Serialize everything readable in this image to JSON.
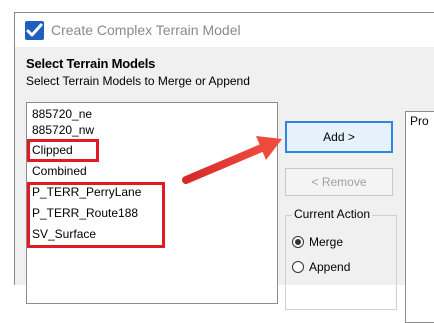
{
  "window": {
    "title": "Create Complex Terrain Model"
  },
  "section": {
    "title": "Select Terrain Models",
    "description": "Select Terrain Models to Merge or Append"
  },
  "terrain_list": {
    "items": [
      "885720_ne",
      "885720_nw",
      "Clipped",
      "Combined",
      "P_TERR_PerryLane",
      "P_TERR_Route188",
      "SV_Surface"
    ]
  },
  "buttons": {
    "add": "Add >",
    "remove": "< Remove"
  },
  "current_action": {
    "legend": "Current Action",
    "options": [
      "Merge",
      "Append"
    ],
    "selected": "Merge"
  },
  "properties_panel": {
    "header": "Pro"
  },
  "colors": {
    "highlight": "#e01b24",
    "accent": "#2e86de",
    "app_icon": "#1f5fbf"
  }
}
